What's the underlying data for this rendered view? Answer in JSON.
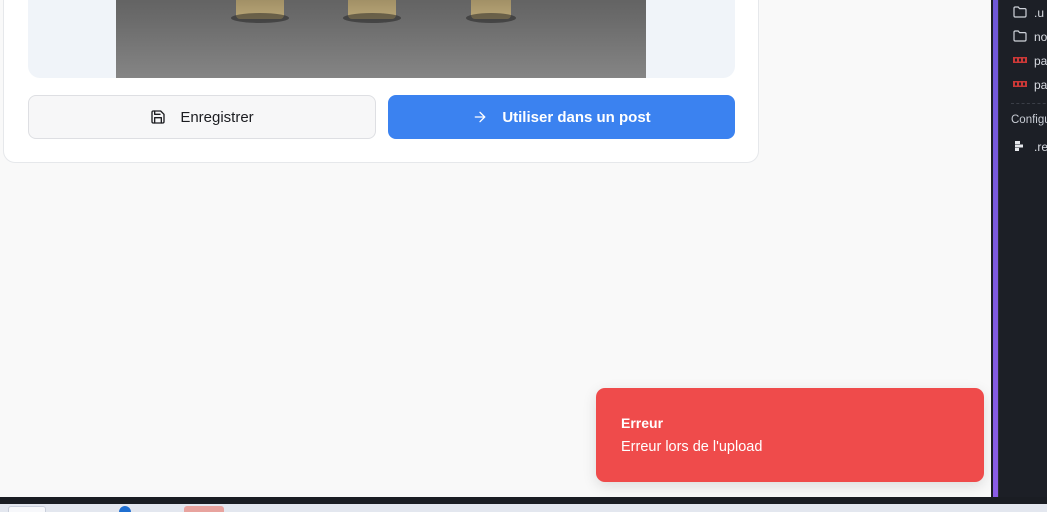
{
  "actions": {
    "save_label": "Enregistrer",
    "use_label": "Utiliser dans un post"
  },
  "toast": {
    "title": "Erreur",
    "message": "Erreur lors de l'upload"
  },
  "explorer": {
    "items": [
      {
        "icon": "folder-icon",
        "label": ".u"
      },
      {
        "icon": "folder-icon",
        "label": "no"
      },
      {
        "icon": "npm-icon",
        "label": "pa"
      },
      {
        "icon": "npm-icon",
        "label": "pa"
      }
    ],
    "section_label": "Configu",
    "config_items": [
      {
        "icon": "config-file-icon",
        "label": ".re"
      }
    ]
  },
  "colors": {
    "primary": "#3b82f0",
    "error": "#ef4b4b",
    "accent_bar": "#7b5ce0"
  }
}
